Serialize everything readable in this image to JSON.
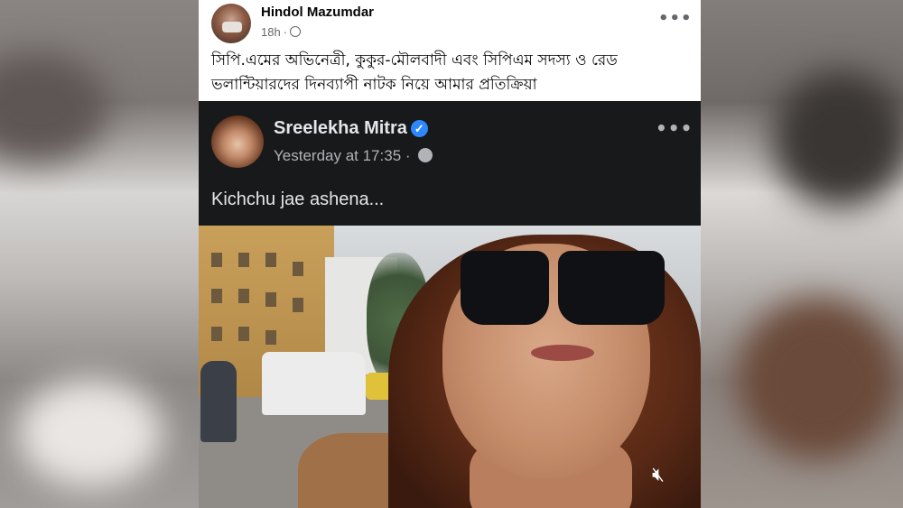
{
  "post": {
    "author": "Hindol Mazumdar",
    "time": "18h",
    "text": "সিপি.এমের অভিনেত্রী, কুকুর-মৌলবাদী এবং সিপিএম সদস্য ও রেড ভলান্টিয়ারদের দিনব্যাপী নাটক নিয়ে আমার প্রতিক্রিয়া",
    "more_icon": "more-options-icon",
    "privacy_icon": "globe-icon"
  },
  "embedded": {
    "author": "Sreelekha Mitra",
    "verified_icon": "verified-badge-icon",
    "time": "Yesterday at 17:35",
    "separator": "·",
    "text": "Kichchu jae ashena...",
    "mute_icon": "speaker-muted-icon"
  },
  "colors": {
    "embed_bg": "#18191a",
    "verified": "#2d88ff",
    "text_primary": "#050505",
    "text_secondary": "#65676b"
  }
}
